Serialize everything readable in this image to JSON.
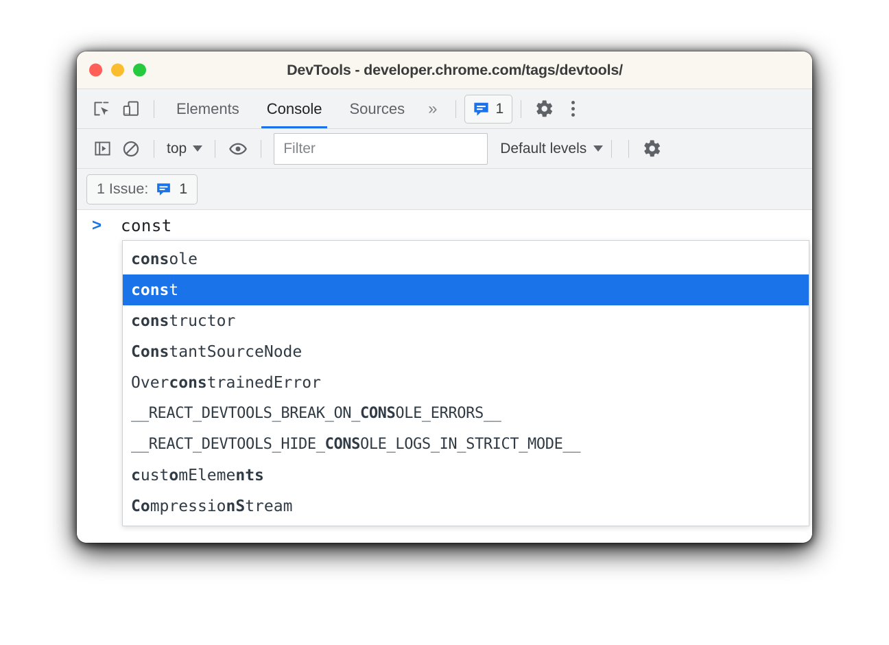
{
  "window": {
    "title": "DevTools - developer.chrome.com/tags/devtools/",
    "traffic_lights": [
      {
        "name": "close",
        "color": "#ff5f56"
      },
      {
        "name": "minimize",
        "color": "#fbbd2e"
      },
      {
        "name": "maximize",
        "color": "#27c93f"
      }
    ]
  },
  "tabbar": {
    "inspect_icon": "inspect-element-icon",
    "device_icon": "device-toolbar-icon",
    "tabs": [
      {
        "label": "Elements",
        "active": false
      },
      {
        "label": "Console",
        "active": true
      },
      {
        "label": "Sources",
        "active": false
      }
    ],
    "more_tabs": "»",
    "issues_count": "1",
    "settings_icon": "gear-icon",
    "menu_icon": "kebab-menu-icon"
  },
  "console_toolbar": {
    "sidebar_icon": "console-sidebar-icon",
    "clear_icon": "clear-console-icon",
    "context": "top",
    "eye_icon": "live-expression-eye-icon",
    "filter_placeholder": "Filter",
    "filter_value": "",
    "levels": "Default levels",
    "settings_icon": "console-settings-gear-icon"
  },
  "issues_bar": {
    "label": "1 Issue:",
    "count": "1"
  },
  "console": {
    "prompt_symbol": ">",
    "input_value": "const"
  },
  "autocomplete": {
    "items": [
      {
        "text": "console",
        "parts": [
          {
            "t": "cons",
            "b": true
          },
          {
            "t": "ole",
            "b": false
          }
        ],
        "selected": false,
        "wide": false
      },
      {
        "text": "const",
        "parts": [
          {
            "t": "cons",
            "b": true
          },
          {
            "t": "t",
            "b": false
          }
        ],
        "selected": true,
        "wide": false
      },
      {
        "text": "constructor",
        "parts": [
          {
            "t": "cons",
            "b": true
          },
          {
            "t": "tructor",
            "b": false
          }
        ],
        "selected": false,
        "wide": false
      },
      {
        "text": "ConstantSourceNode",
        "parts": [
          {
            "t": "Cons",
            "b": true
          },
          {
            "t": "tantSourceNode",
            "b": false
          }
        ],
        "selected": false,
        "wide": false
      },
      {
        "text": "OverconstrainedError",
        "parts": [
          {
            "t": "Over",
            "b": false
          },
          {
            "t": "cons",
            "b": true
          },
          {
            "t": "trainedError",
            "b": false
          }
        ],
        "selected": false,
        "wide": false
      },
      {
        "text": "__REACT_DEVTOOLS_BREAK_ON_CONSOLE_ERRORS__",
        "parts": [
          {
            "t": "__REACT_DEVTOOLS_BREAK_ON_",
            "b": false
          },
          {
            "t": "CONS",
            "b": true
          },
          {
            "t": "OLE_ERRORS__",
            "b": false
          }
        ],
        "selected": false,
        "wide": true
      },
      {
        "text": "__REACT_DEVTOOLS_HIDE_CONSOLE_LOGS_IN_STRICT_MODE__",
        "parts": [
          {
            "t": "__REACT_DEVTOOLS_HIDE_",
            "b": false
          },
          {
            "t": "CONS",
            "b": true
          },
          {
            "t": "OLE_LOGS_IN_STRICT_MODE__",
            "b": false
          }
        ],
        "selected": false,
        "wide": true
      },
      {
        "text": "customElements",
        "parts": [
          {
            "t": "c",
            "b": true
          },
          {
            "t": "ust",
            "b": false
          },
          {
            "t": "o",
            "b": true
          },
          {
            "t": "mEleme",
            "b": false
          },
          {
            "t": "nts",
            "b": true
          }
        ],
        "selected": false,
        "wide": false
      },
      {
        "text": "CompressionStream",
        "parts": [
          {
            "t": "Co",
            "b": true
          },
          {
            "t": "mpressio",
            "b": false
          },
          {
            "t": "n",
            "b": true
          },
          {
            "t": "",
            "b": false
          },
          {
            "t": "S",
            "b": true
          },
          {
            "t": "tream",
            "b": false
          }
        ],
        "selected": false,
        "wide": false
      }
    ]
  },
  "colors": {
    "accent": "#1a73e8",
    "titlebar_bg": "#faf6f0",
    "toolbar_bg": "#f1f3f4",
    "text": "#3c4043"
  }
}
